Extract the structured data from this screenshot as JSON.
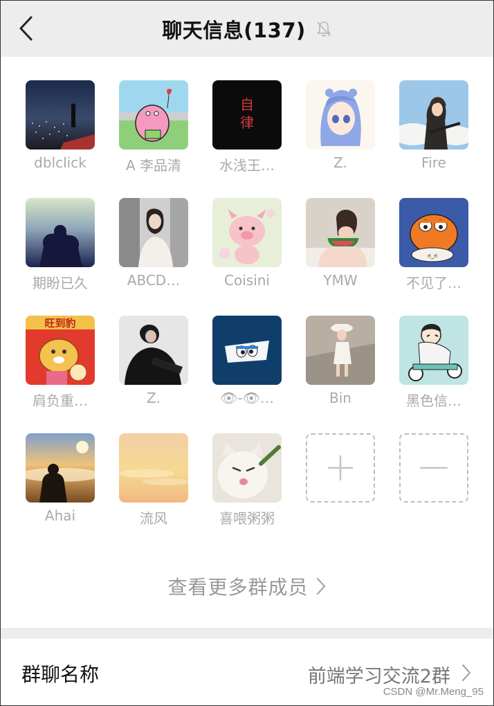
{
  "header": {
    "title": "聊天信息(137)",
    "back_icon": "chevron-left-icon",
    "mute_icon": "bell-off-icon"
  },
  "members": [
    {
      "name": "dblclick",
      "avatar": "night-city-avatar"
    },
    {
      "name": "A 李品清",
      "avatar": "patrick-star-avatar"
    },
    {
      "name": "水浅王…",
      "avatar": "zilv-text-avatar"
    },
    {
      "name": "Z.",
      "avatar": "anime-girl-avatar"
    },
    {
      "name": "Fire",
      "avatar": "anime-gunner-avatar"
    },
    {
      "name": "期盼已久",
      "avatar": "silhouette-avatar"
    },
    {
      "name": "ABCD…",
      "avatar": "woman-photo-avatar"
    },
    {
      "name": "Coisini",
      "avatar": "pink-pig-avatar"
    },
    {
      "name": "YMW",
      "avatar": "watermelon-girl-avatar"
    },
    {
      "name": "不见了…",
      "avatar": "garfield-avatar"
    },
    {
      "name": "肩负重…",
      "avatar": "lion-fortune-avatar"
    },
    {
      "name": "Z.",
      "avatar": "man-black-shirt-avatar"
    },
    {
      "name": "👁‍‍-👁…",
      "avatar": "peeking-cartoon-avatar"
    },
    {
      "name": "Bin",
      "avatar": "toddler-avatar"
    },
    {
      "name": "黑色信…",
      "avatar": "scooter-cartoon-avatar"
    },
    {
      "name": "Ahai",
      "avatar": "sunset-man-avatar"
    },
    {
      "name": "流风",
      "avatar": "sunset-sky-avatar"
    },
    {
      "name": "喜喂粥粥",
      "avatar": "white-cat-avatar"
    }
  ],
  "actions": {
    "add_icon": "plus-icon",
    "remove_icon": "minus-icon"
  },
  "see_more": {
    "label": "查看更多群成员",
    "icon": "chevron-right-icon"
  },
  "group_name_row": {
    "label": "群聊名称",
    "value": "前端学习交流2群",
    "icon": "chevron-right-icon"
  },
  "watermark": "CSDN @Mr.Meng_95"
}
